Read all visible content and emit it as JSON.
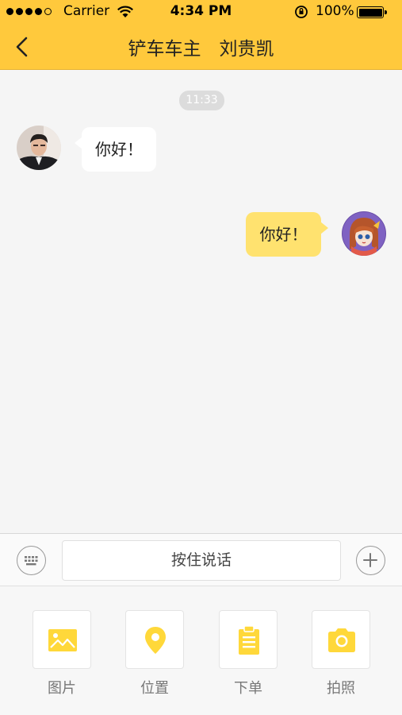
{
  "status_bar": {
    "carrier": "Carrier",
    "time": "4:34 PM",
    "battery": "100%"
  },
  "nav": {
    "title": "铲车车主　刘贵凯"
  },
  "chat": {
    "timestamp": "11:33",
    "messages": [
      {
        "side": "left",
        "text": "你好！"
      },
      {
        "side": "right",
        "text": "你好！"
      }
    ]
  },
  "input_bar": {
    "voice_label": "按住说话"
  },
  "tools": {
    "items": [
      {
        "label": "图片",
        "icon": "image-icon"
      },
      {
        "label": "位置",
        "icon": "location-pin-icon"
      },
      {
        "label": "下单",
        "icon": "clipboard-icon"
      },
      {
        "label": "拍照",
        "icon": "camera-icon"
      }
    ]
  },
  "colors": {
    "header_yellow": "#ffc93c",
    "outgoing_bubble": "#ffe26f",
    "tool_icon_yellow": "#ffd83a",
    "background": "#f5f5f5"
  }
}
